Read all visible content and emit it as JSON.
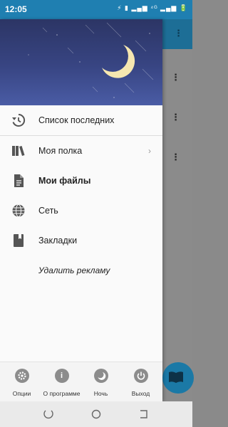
{
  "status_bar": {
    "time": "12:05",
    "icons_text": "⚡ ▮ ▂▄▆ ⁴ᴳ ▂▄▆ 🔋"
  },
  "drawer": {
    "menu": [
      {
        "label": "Список последних",
        "icon": "history-icon"
      },
      {
        "label": "Моя полка",
        "icon": "books-icon",
        "chevron": true
      },
      {
        "label": "Мои файлы",
        "icon": "file-icon",
        "bold": true
      },
      {
        "label": "Сеть",
        "icon": "globe-icon"
      },
      {
        "label": "Закладки",
        "icon": "bookmark-icon"
      }
    ],
    "remove_ads": "Удалить рекламу",
    "bottom": [
      {
        "label": "Опции",
        "icon": "gear-icon"
      },
      {
        "label": "О программе",
        "icon": "info-icon",
        "glyph": "i"
      },
      {
        "label": "Ночь",
        "icon": "moon-icon"
      },
      {
        "label": "Выход",
        "icon": "power-icon"
      }
    ]
  },
  "colors": {
    "status_bar": "#1f7fb1",
    "toolbar": "#1d6e96",
    "header_top": "#2c3565",
    "header_bottom": "#4a5ca5",
    "moon": "#f6e7b0"
  }
}
